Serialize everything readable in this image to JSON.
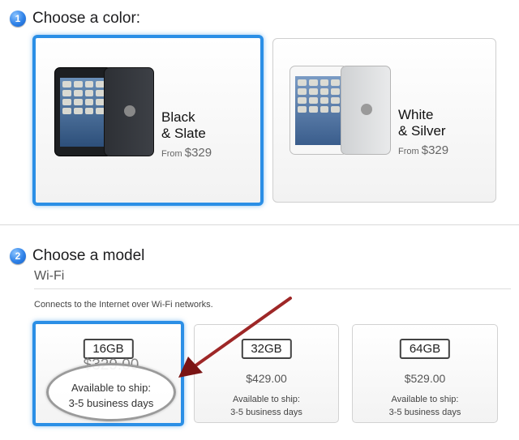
{
  "step1": {
    "number": "1",
    "title": "Choose a color:"
  },
  "colors": [
    {
      "name_line1": "Black",
      "name_line2": "& Slate",
      "from": "From",
      "price": "$329",
      "selected": true
    },
    {
      "name_line1": "White",
      "name_line2": "& Silver",
      "from": "From",
      "price": "$329",
      "selected": false
    }
  ],
  "step2": {
    "number": "2",
    "title": "Choose a model"
  },
  "wifi": {
    "label": "Wi-Fi",
    "description": "Connects to the Internet over Wi-Fi networks."
  },
  "models": [
    {
      "capacity": "16GB",
      "price": "$329.00",
      "avail_line1": "Available to ship:",
      "avail_line2": "3-5 business days",
      "selected": true
    },
    {
      "capacity": "32GB",
      "price": "$429.00",
      "avail_line1": "Available to ship:",
      "avail_line2": "3-5 business days",
      "selected": false
    },
    {
      "capacity": "64GB",
      "price": "$529.00",
      "avail_line1": "Available to ship:",
      "avail_line2": "3-5 business days",
      "selected": false
    }
  ],
  "colors_accent": {
    "selection_blue": "#2b8fe6",
    "arrow_red": "#8b1a1a"
  }
}
